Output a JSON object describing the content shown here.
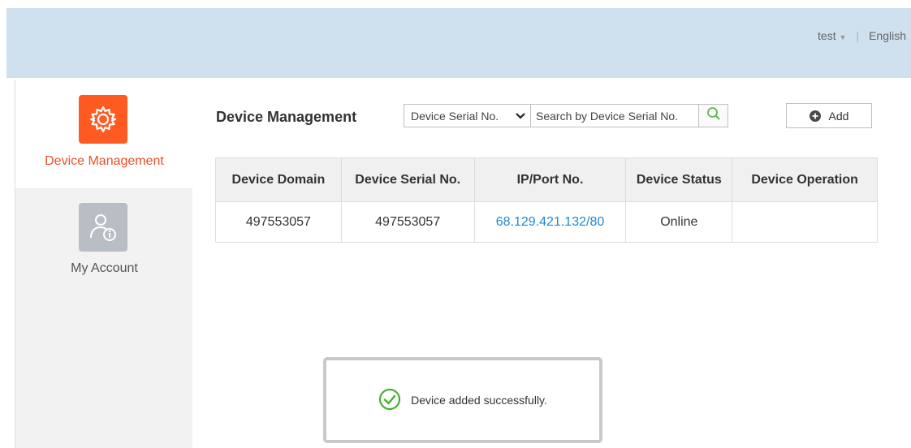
{
  "header": {
    "user": "test",
    "language": "English"
  },
  "sidebar": {
    "items": [
      {
        "label": "Device Management",
        "icon": "gear-icon",
        "active": true
      },
      {
        "label": "My Account",
        "icon": "account-info-icon",
        "active": false
      }
    ]
  },
  "main": {
    "title": "Device Management",
    "search": {
      "selected_field": "Device Serial No.",
      "placeholder": "Search by Device Serial No."
    },
    "add_label": "Add"
  },
  "table": {
    "columns": [
      "Device Domain",
      "Device Serial No.",
      "IP/Port No.",
      "Device Status",
      "Device Operation"
    ],
    "rows": [
      {
        "domain": "497553057",
        "serial": "497553057",
        "ip": "68.129.421.132",
        "port_separator": "/",
        "port": "80",
        "status": "Online",
        "operation": ""
      }
    ]
  },
  "toast": {
    "message": "Device added successfully."
  },
  "colors": {
    "accent": "#ff5a22",
    "active_label": "#e8502a",
    "link": "#1e88d6",
    "online": "#45b02e",
    "header_bg": "#cfe0ee"
  }
}
